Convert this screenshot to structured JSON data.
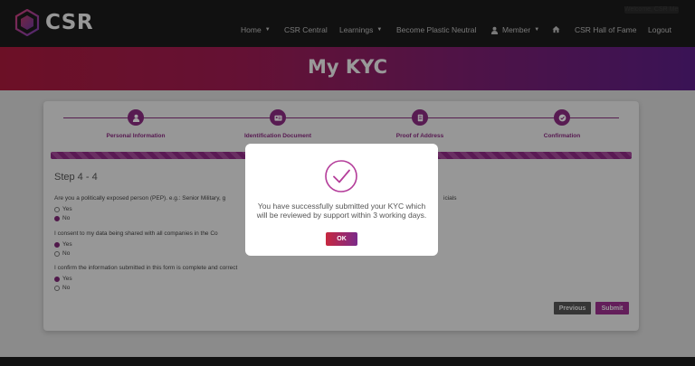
{
  "brand": {
    "name": "CSR"
  },
  "top_bar": {
    "user_text": "Welcome, CSR Member"
  },
  "nav": {
    "items": [
      {
        "label": "Home",
        "dropdown": true
      },
      {
        "label": "CSR Central",
        "dropdown": false
      },
      {
        "label": "Learnings",
        "dropdown": true
      },
      {
        "label": "Become Plastic Neutral",
        "dropdown": false
      },
      {
        "label": "Member",
        "dropdown": true,
        "icon": "user-icon"
      },
      {
        "label": "",
        "icon": "home-icon"
      },
      {
        "label": "CSR Hall of Fame",
        "dropdown": false
      },
      {
        "label": "Logout",
        "dropdown": false
      }
    ],
    "caret": "▼"
  },
  "banner": {
    "title": "My KYC"
  },
  "progress": {
    "steps": [
      {
        "label": "Personal Information",
        "icon": "user-icon"
      },
      {
        "label": "Identification Document",
        "icon": "id-card-icon"
      },
      {
        "label": "Proof of Address",
        "icon": "document-icon"
      },
      {
        "label": "Confirmation",
        "icon": "check-circle-icon"
      }
    ]
  },
  "form": {
    "step_heading": "Step 4 - 4",
    "questions": [
      {
        "text": "Are you a politically exposed person (PEP). e.g.: Senior Military, g",
        "text_after_modal": "icials",
        "options": [
          {
            "label": "Yes",
            "selected": false
          },
          {
            "label": "No",
            "selected": true
          }
        ]
      },
      {
        "text": "I consent to my data being shared with all companies in the Co",
        "options": [
          {
            "label": "Yes",
            "selected": true
          },
          {
            "label": "No",
            "selected": false
          }
        ]
      },
      {
        "text": "I confirm the information submitted in this form is complete and correct",
        "options": [
          {
            "label": "Yes",
            "selected": true
          },
          {
            "label": "No",
            "selected": false
          }
        ]
      }
    ],
    "previous_label": "Previous",
    "submit_label": "Submit"
  },
  "modal": {
    "icon": "check-circle-icon",
    "message": "You have successfully submitted your KYC which will be reviewed by support within 3 working days.",
    "ok_label": "OK"
  },
  "colors": {
    "nav_bg": "#1b1b1b",
    "accent": "#8a2b80",
    "banner_start": "#aa1a3c",
    "banner_end": "#5b1f86",
    "ok_start": "#c7283f",
    "ok_end": "#7b2a8a"
  }
}
